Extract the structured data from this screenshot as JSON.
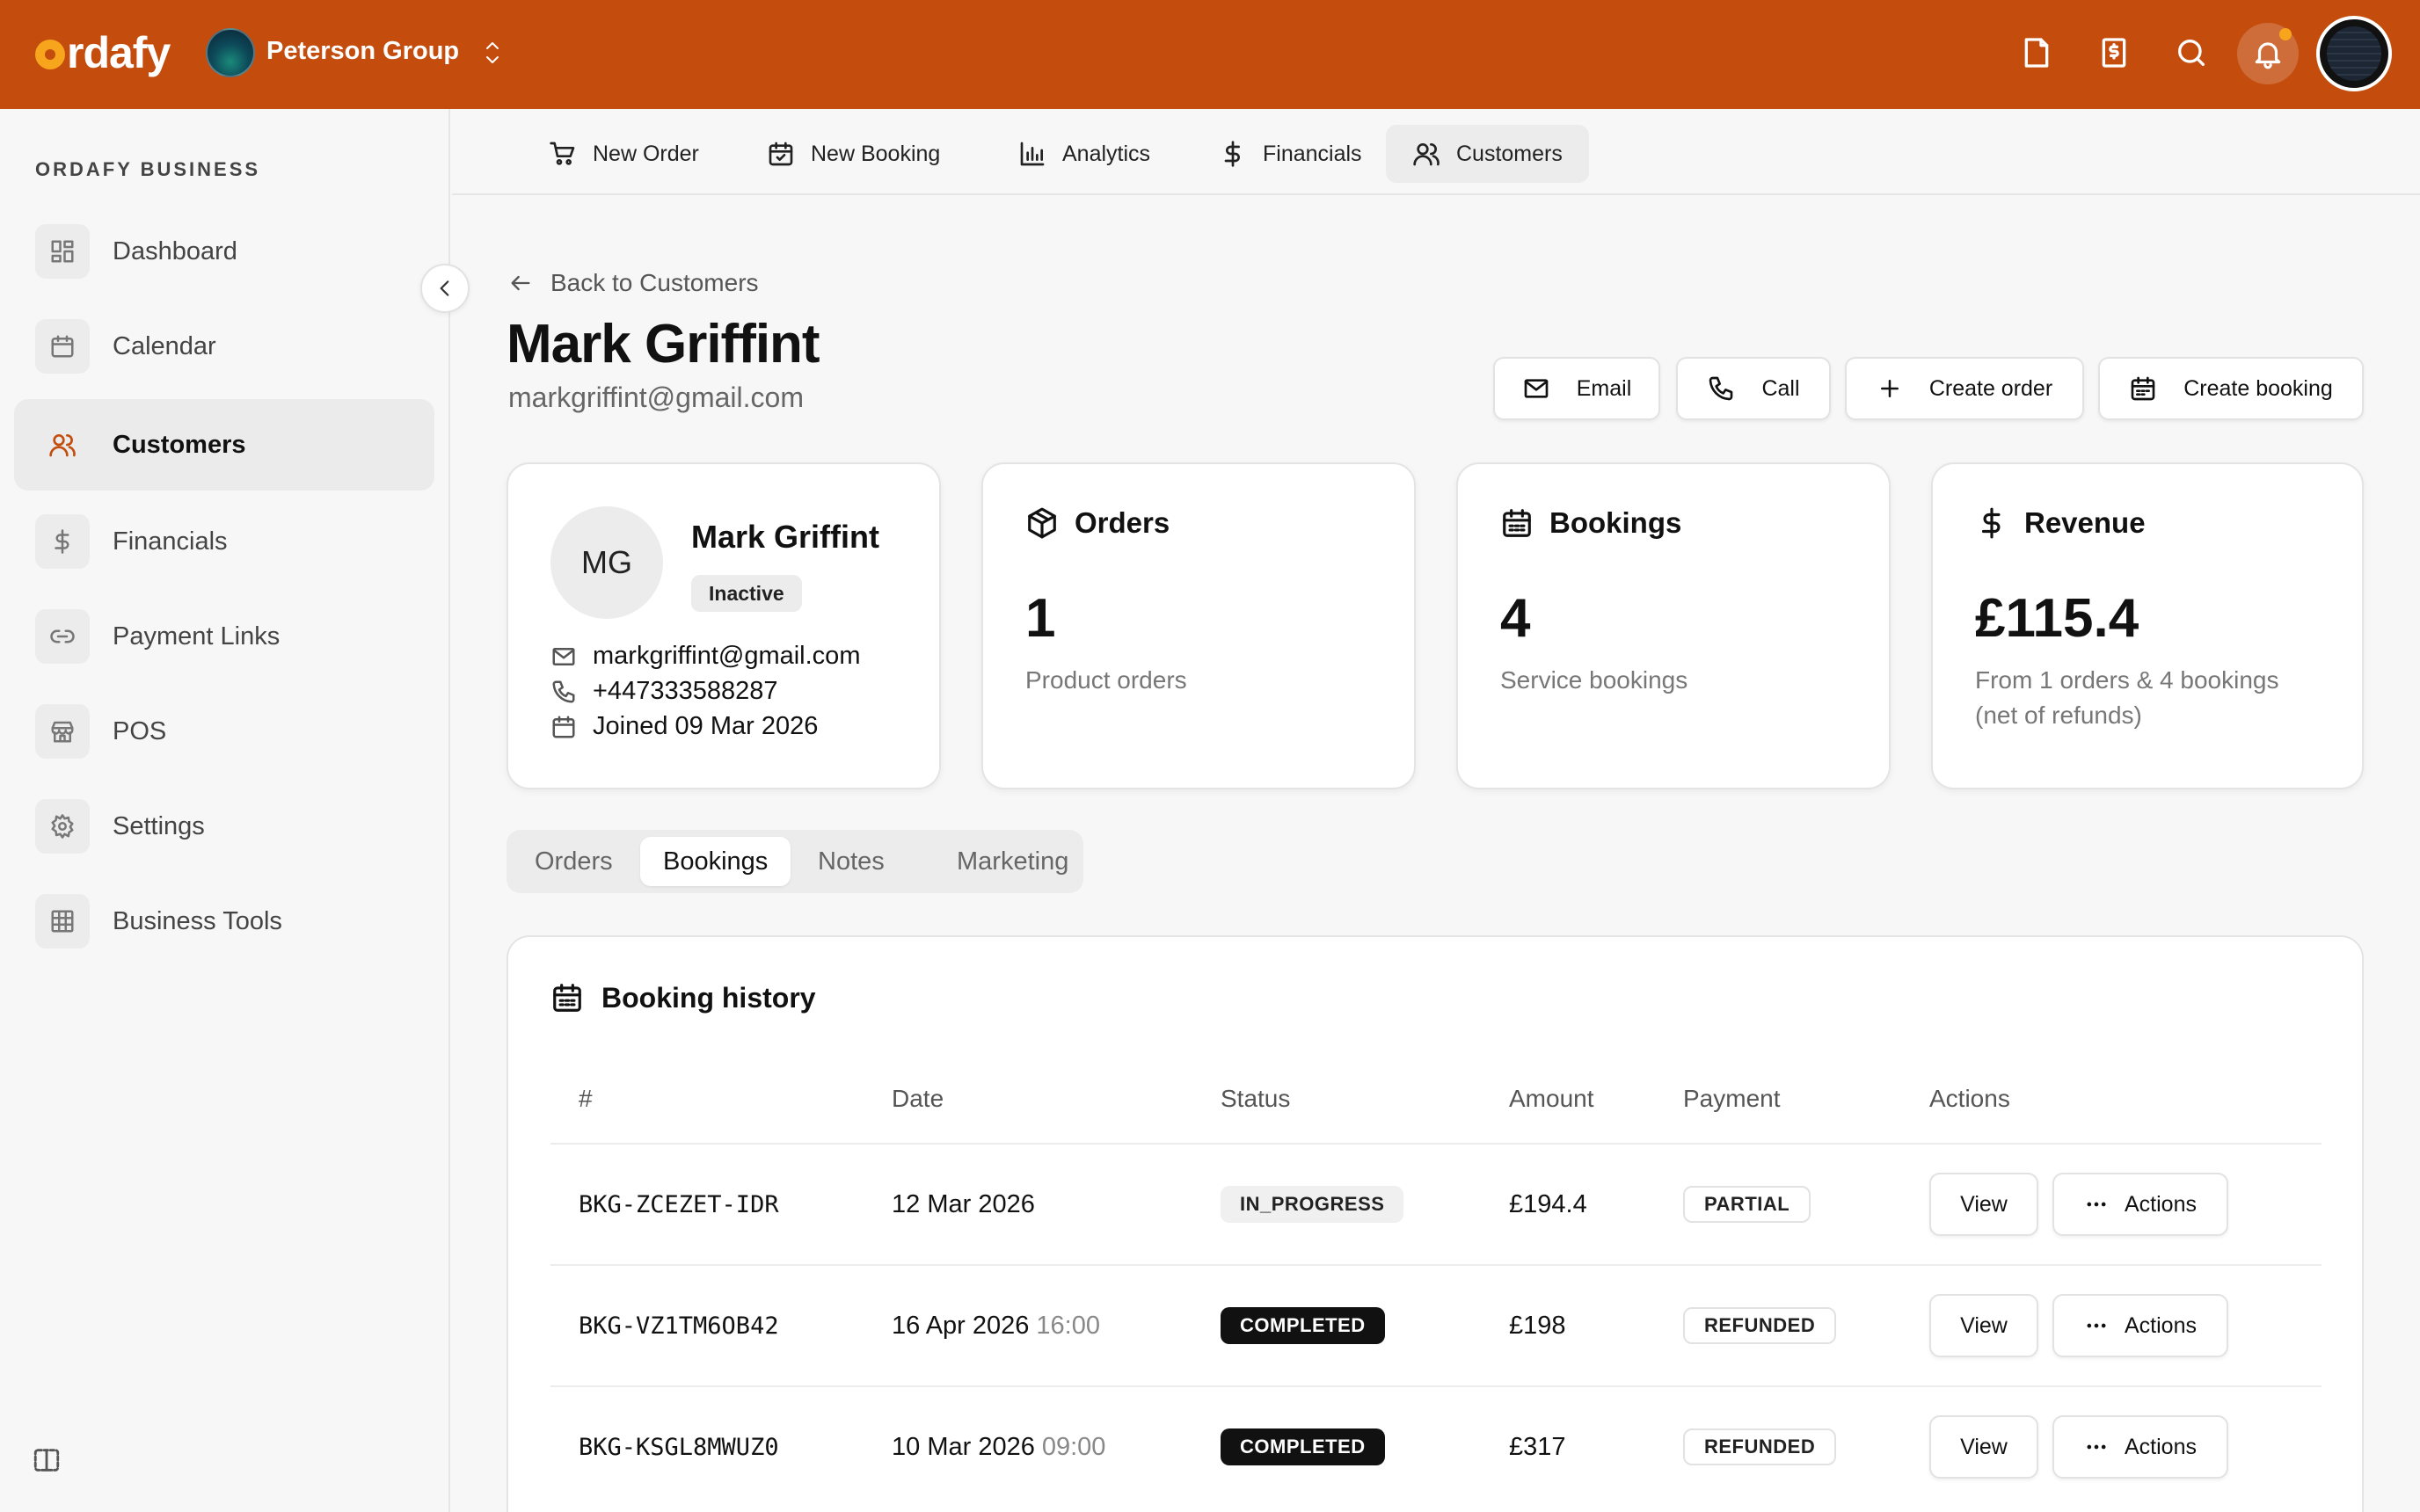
{
  "topbar": {
    "logo_text": "rdafy",
    "org_name": "Peterson Group",
    "brand_color": "#c44d0e"
  },
  "sidebar": {
    "section_title": "ORDAFY BUSINESS",
    "items": [
      {
        "label": "Dashboard",
        "icon": "dashboard-icon"
      },
      {
        "label": "Calendar",
        "icon": "calendar-icon"
      },
      {
        "label": "Customers",
        "icon": "users-icon",
        "active": true
      },
      {
        "label": "Financials",
        "icon": "dollar-icon"
      },
      {
        "label": "Payment Links",
        "icon": "link-icon"
      },
      {
        "label": "POS",
        "icon": "store-icon"
      },
      {
        "label": "Settings",
        "icon": "gear-icon"
      },
      {
        "label": "Business Tools",
        "icon": "grid-icon"
      }
    ]
  },
  "subnav": {
    "items": [
      {
        "label": "New Order",
        "icon": "cart-icon"
      },
      {
        "label": "New Booking",
        "icon": "calendar-check-icon"
      },
      {
        "label": "Analytics",
        "icon": "bar-chart-icon"
      },
      {
        "label": "Financials",
        "icon": "dollar-icon"
      },
      {
        "label": "Customers",
        "icon": "users-icon",
        "active": true
      }
    ]
  },
  "header": {
    "back_label": "Back to Customers",
    "title": "Mark Griffint",
    "subtitle": "markgriffint@gmail.com",
    "actions": {
      "email": "Email",
      "call": "Call",
      "create_order": "Create order",
      "create_booking": "Create booking"
    }
  },
  "profile": {
    "initials": "MG",
    "name": "Mark Griffint",
    "status": "Inactive",
    "email": "markgriffint@gmail.com",
    "phone": "+447333588287",
    "joined": "Joined 09 Mar 2026"
  },
  "stats": {
    "orders": {
      "title": "Orders",
      "value": "1",
      "desc": "Product orders"
    },
    "bookings": {
      "title": "Bookings",
      "value": "4",
      "desc": "Service bookings"
    },
    "revenue": {
      "title": "Revenue",
      "value": "£115.4",
      "desc_line1": "From 1 orders & 4 bookings",
      "desc_line2": "(net of refunds)"
    }
  },
  "tabs": [
    {
      "label": "Orders"
    },
    {
      "label": "Bookings",
      "active": true
    },
    {
      "label": "Notes"
    },
    {
      "label": "Marketing"
    }
  ],
  "history": {
    "title": "Booking history",
    "columns": [
      "#",
      "Date",
      "Status",
      "Amount",
      "Payment",
      "Actions"
    ],
    "view_label": "View",
    "actions_label": "Actions",
    "rows": [
      {
        "id": "BKG-ZCEZET-IDR",
        "date": "12 Mar 2026",
        "time": "",
        "status": "IN_PROGRESS",
        "amount": "£194.4",
        "payment": "PARTIAL"
      },
      {
        "id": "BKG-VZ1TM6OB42",
        "date": "16 Apr 2026",
        "time": "16:00",
        "status": "COMPLETED",
        "amount": "£198",
        "payment": "REFUNDED"
      },
      {
        "id": "BKG-KSGL8MWUZ0",
        "date": "10 Mar 2026",
        "time": "09:00",
        "status": "COMPLETED",
        "amount": "£317",
        "payment": "REFUNDED"
      }
    ]
  }
}
